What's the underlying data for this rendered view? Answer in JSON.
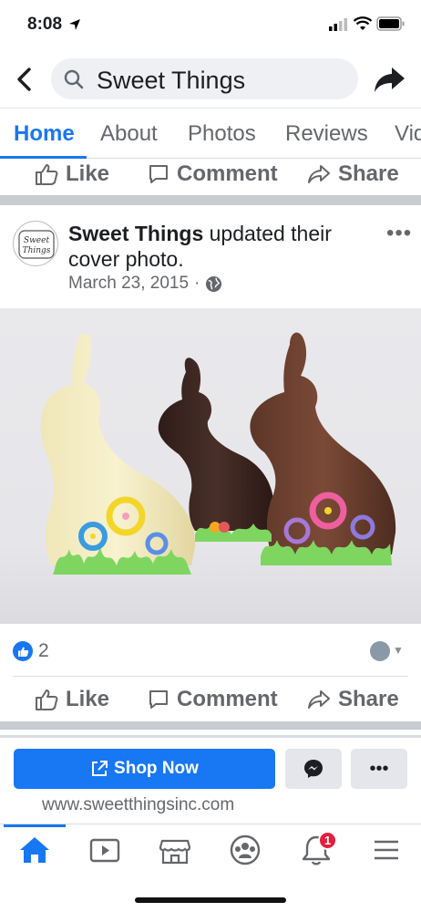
{
  "status_bar": {
    "time": "8:08"
  },
  "header": {
    "search_text": "Sweet Things"
  },
  "tabs": [
    {
      "label": "Home",
      "active": true
    },
    {
      "label": "About"
    },
    {
      "label": "Photos"
    },
    {
      "label": "Reviews"
    },
    {
      "label": "Vid"
    }
  ],
  "actions": {
    "like": "Like",
    "comment": "Comment",
    "share": "Share"
  },
  "post": {
    "avatar_text": "Sweet Things",
    "page_name": "Sweet Things",
    "headline_rest": " updated their cover photo.",
    "date": "March 23, 2015",
    "separator": "·",
    "more": "•••",
    "likes_count": "2"
  },
  "shop_bar": {
    "shop_label": "Shop Now",
    "more_label": "•••",
    "website": "www.sweetthingsinc.com"
  },
  "bottom_nav": {
    "items": [
      "home-icon",
      "watch-icon",
      "marketplace-icon",
      "groups-icon",
      "notifications-icon",
      "menu-icon"
    ],
    "notification_count": "1"
  },
  "colors": {
    "accent": "#1877f2",
    "badge": "#e41e3f"
  }
}
